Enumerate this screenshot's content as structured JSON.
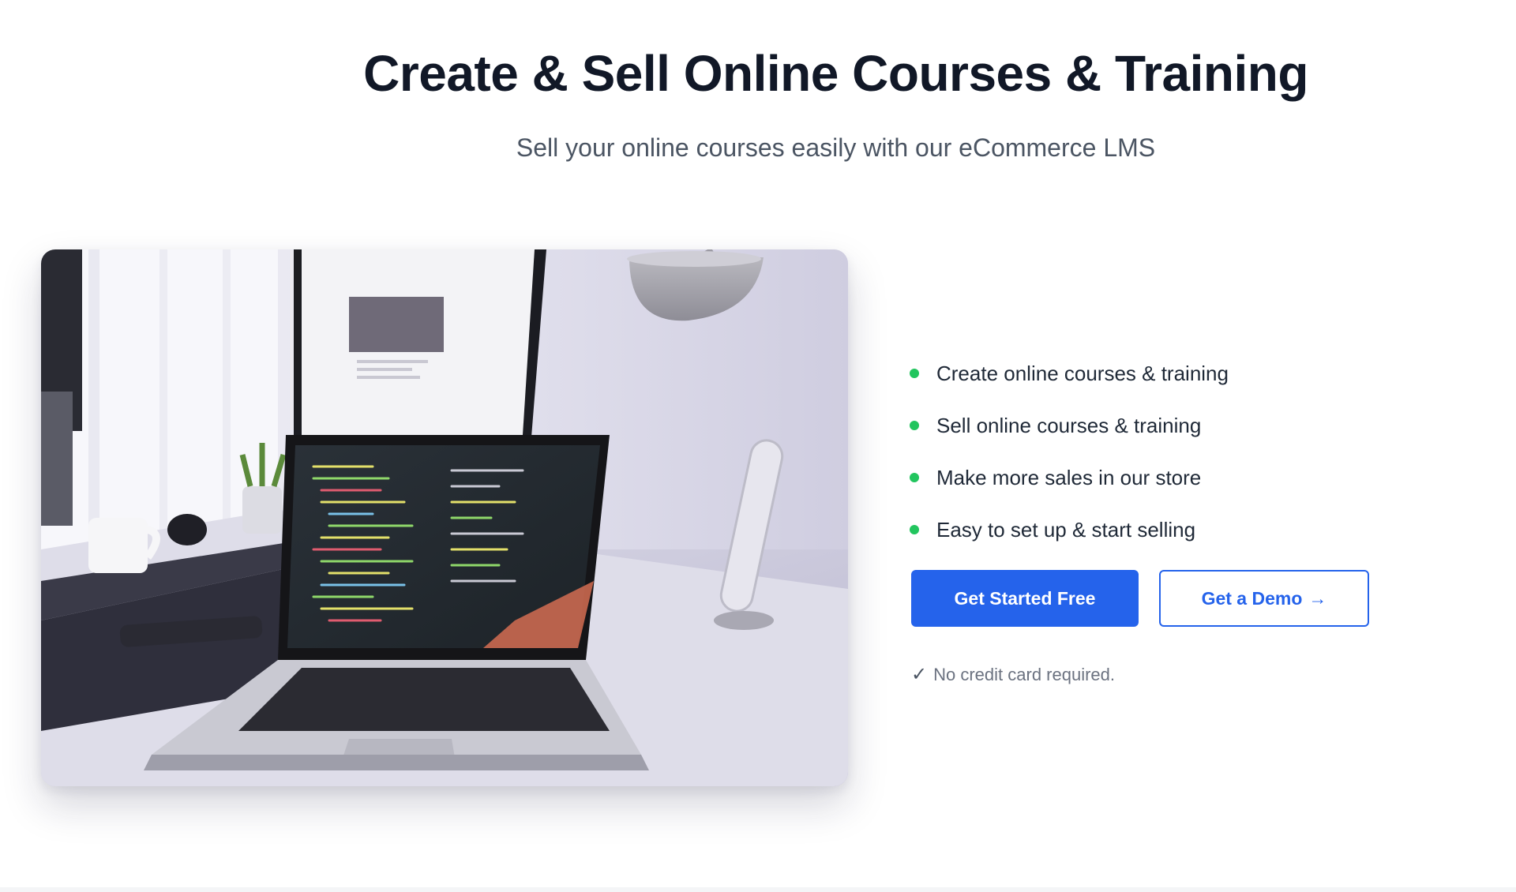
{
  "hero": {
    "title": "Create & Sell Online Courses & Training",
    "subtitle": "Sell your online courses easily with our eCommerce LMS"
  },
  "features": [
    {
      "label": "Create online courses & training"
    },
    {
      "label": "Sell online courses & training"
    },
    {
      "label": "Make more sales in our store"
    },
    {
      "label": "Easy to set up & start selling"
    }
  ],
  "cta": {
    "primary_label": "Get Started Free",
    "secondary_label": "Get a Demo",
    "secondary_icon": "arrow-right-icon"
  },
  "note": {
    "icon": "check-icon",
    "text": "No credit card required."
  },
  "colors": {
    "accent": "#2563eb",
    "bullet": "#22c55e",
    "title": "#111827",
    "subtitle": "#4b5563"
  }
}
